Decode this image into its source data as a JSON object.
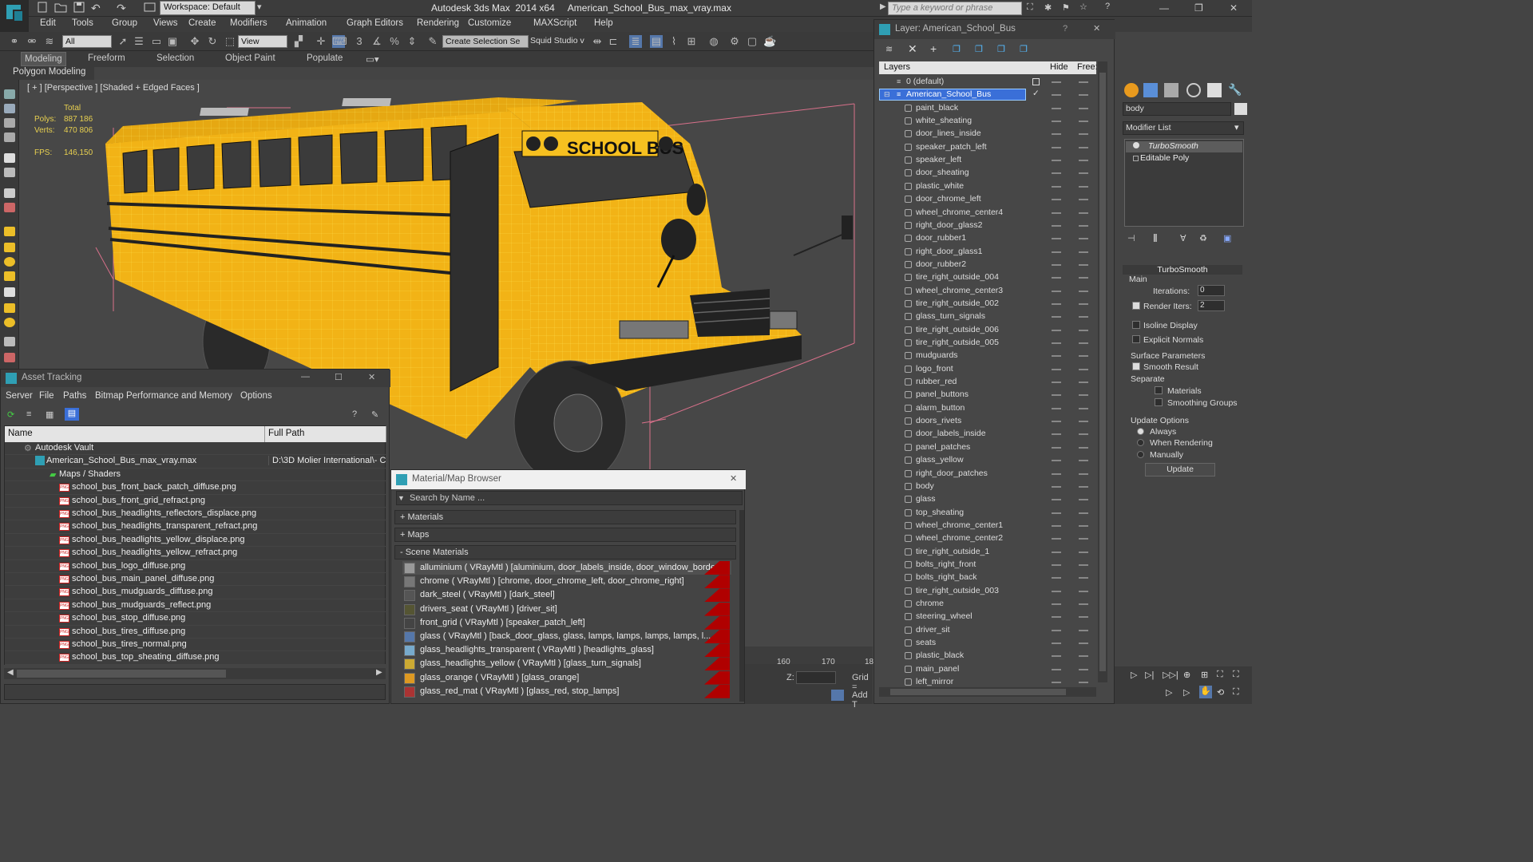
{
  "titlebar": {
    "workspace": "Workspace: Default",
    "title": "Autodesk 3ds Max  2014 x64     American_School_Bus_max_vray.max",
    "search_placeholder": "Type a keyword or phrase"
  },
  "menu": [
    "Edit",
    "Tools",
    "Group",
    "Views",
    "Create",
    "Modifiers",
    "Animation",
    "Graph Editors",
    "Rendering",
    "Customize",
    "MAXScript",
    "Help"
  ],
  "toolbar": {
    "selection_filter": "All",
    "ref_coord": "View",
    "selection_set": "Create Selection Se",
    "squid": "Squid Studio v"
  },
  "ribbon": {
    "tabs": [
      "Modeling",
      "Freeform",
      "Selection",
      "Object Paint",
      "Populate"
    ],
    "active": "Modeling",
    "panel": "Polygon Modeling"
  },
  "viewport": {
    "label": "[ + ] [Perspective ] [Shaded + Edged Faces ]",
    "total_label": "Total",
    "polys_label": "Polys:",
    "polys": "887 186",
    "verts_label": "Verts:",
    "verts": "470 806",
    "fps_label": "FPS:",
    "fps": "146,150",
    "bus_sign": "SCHOOL BUS"
  },
  "asset_tracking": {
    "title": "Asset Tracking",
    "menu": [
      "Server",
      "File",
      "Paths",
      "Bitmap Performance and Memory",
      "Options"
    ],
    "col_name": "Name",
    "col_path": "Full Path",
    "vault": "Autodesk Vault",
    "file": "American_School_Bus_max_vray.max",
    "file_path": "D:\\3D Molier International\\- C",
    "maps_folder": "Maps / Shaders",
    "maps": [
      "school_bus_front_back_patch_diffuse.png",
      "school_bus_front_grid_refract.png",
      "school_bus_headlights_reflectors_displace.png",
      "school_bus_headlights_transparent_refract.png",
      "school_bus_headlights_yellow_displace.png",
      "school_bus_headlights_yellow_refract.png",
      "school_bus_logo_diffuse.png",
      "school_bus_main_panel_diffuse.png",
      "school_bus_mudguards_diffuse.png",
      "school_bus_mudguards_reflect.png",
      "school_bus_stop_diffuse.png",
      "school_bus_tires_diffuse.png",
      "school_bus_tires_normal.png",
      "school_bus_top_sheating_diffuse.png"
    ]
  },
  "material_browser": {
    "title": "Material/Map Browser",
    "search": "Search by Name ...",
    "sections": [
      "+ Materials",
      "+ Maps",
      "- Scene Materials"
    ],
    "materials": [
      "alluminium  ( VRayMtl )  [aluminium, door_labels_inside, door_window_border]",
      "chrome  ( VRayMtl )  [chrome, door_chrome_left, door_chrome_right]",
      "dark_steel  ( VRayMtl )  [dark_steel]",
      "drivers_seat  ( VRayMtl )  [driver_sit]",
      "front_grid  ( VRayMtl )  [speaker_patch_left]",
      "glass  ( VRayMtl )  [back_door_glass, glass, lamps, lamps, lamps, lamps, l...",
      "glass_headlights_transparent  ( VRayMtl )  [headlights_glass]",
      "glass_headlights_yellow  ( VRayMtl )  [glass_turn_signals]",
      "glass_orange  ( VRayMtl )  [glass_orange]",
      "glass_red_mat  ( VRayMtl )  [glass_red, stop_lamps]"
    ]
  },
  "layer_panel": {
    "title": "Layer: American_School_Bus",
    "col_layers": "Layers",
    "col_hide": "Hide",
    "col_freeze": "Free:",
    "default_layer": "0 (default)",
    "active_layer": "American_School_Bus",
    "objects": [
      "paint_black",
      "white_sheating",
      "door_lines_inside",
      "speaker_patch_left",
      "speaker_left",
      "door_sheating",
      "plastic_white",
      "door_chrome_left",
      "wheel_chrome_center4",
      "right_door_glass2",
      "door_rubber1",
      "right_door_glass1",
      "door_rubber2",
      "tire_right_outside_004",
      "wheel_chrome_center3",
      "tire_right_outside_002",
      "glass_turn_signals",
      "tire_right_outside_006",
      "tire_right_outside_005",
      "mudguards",
      "logo_front",
      "rubber_red",
      "panel_buttons",
      "alarm_button",
      "doors_rivets",
      "door_labels_inside",
      "panel_patches",
      "glass_yellow",
      "right_door_patches",
      "body",
      "glass",
      "top_sheating",
      "wheel_chrome_center1",
      "wheel_chrome_center2",
      "tire_right_outside_1",
      "bolts_right_front",
      "bolts_right_back",
      "tire_right_outside_003",
      "chrome",
      "steering_wheel",
      "driver_sit",
      "seats",
      "plastic_black",
      "main_panel",
      "left_mirror"
    ]
  },
  "command_panel": {
    "object_name": "body",
    "modifier_list": "Modifier List",
    "stack": [
      "TurboSmooth",
      "Editable Poly"
    ],
    "rollout_title": "TurboSmooth",
    "main": "Main",
    "iterations_label": "Iterations:",
    "iterations": "0",
    "render_iters_label": "Render Iters:",
    "render_iters": "2",
    "isoline": "Isoline Display",
    "explicit": "Explicit Normals",
    "surface_params": "Surface Parameters",
    "smooth_result": "Smooth Result",
    "separate": "Separate",
    "materials": "Materials",
    "smoothing_groups": "Smoothing Groups",
    "update_options": "Update Options",
    "always": "Always",
    "when_rendering": "When Rendering",
    "manually": "Manually",
    "update_btn": "Update"
  },
  "timeline": {
    "ticks": [
      "160",
      "170",
      "18"
    ],
    "z_label": "Z:",
    "grid_label": "Grid =",
    "add_t": "Add T"
  },
  "colors": {
    "bus_yellow": "#f2b316",
    "wire": "#ffff66",
    "selected": "#3a6fd8",
    "red_swatch": "#b00000"
  }
}
